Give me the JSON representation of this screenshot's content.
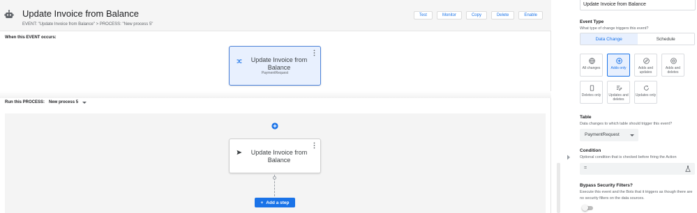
{
  "colors": {
    "accent": "#1a73e8",
    "selected_bg": "#e8f0fe",
    "header_bg": "#f5f5f5",
    "process_bg": "#f4f4f4"
  },
  "header": {
    "title": "Update Invoice from Balance",
    "breadcrumb": "EVENT: \"Update Invoice from Balance\" > PROCESS: \"New process 5\"",
    "icon": "robot-icon",
    "buttons": [
      "Test",
      "Monitor",
      "Copy",
      "Delete",
      "Enable"
    ]
  },
  "event_section": {
    "label": "When this EVENT occurs:",
    "card": {
      "title": "Update Invoice from Balance",
      "subtitle": "PaymentRequest",
      "icon": "shuffle-icon"
    }
  },
  "process_section": {
    "label": "Run this PROCESS:",
    "selected_process": "New process 5",
    "step_card": {
      "title": "Update Invoice from Balance",
      "icon": "send-icon"
    },
    "add_step_label": "Add a step"
  },
  "panel": {
    "name_value": "Update Invoice from Balance",
    "event_type": {
      "title": "Event Type",
      "hint": "What type of change triggers this event?",
      "tabs": [
        "Data Change",
        "Schedule"
      ],
      "active_tab": "Data Change"
    },
    "change_options": [
      {
        "label": "All changes",
        "icon": "globe-icon",
        "active": false
      },
      {
        "label": "Adds only",
        "icon": "add-circle-icon",
        "active": true
      },
      {
        "label": "Adds and updates",
        "icon": "add-update-icon",
        "active": false
      },
      {
        "label": "Adds and deletes",
        "icon": "add-delete-icon",
        "active": false
      },
      {
        "label": "Deletes only",
        "icon": "trash-icon",
        "active": false
      },
      {
        "label": "Updates and deletes",
        "icon": "edit-delete-icon",
        "active": false
      },
      {
        "label": "Updates only",
        "icon": "refresh-icon",
        "active": false
      }
    ],
    "table": {
      "title": "Table",
      "hint": "Data changes to which table should trigger this event?",
      "value": "PaymentRequest"
    },
    "condition": {
      "title": "Condition",
      "hint": "Optional condition that is checked before firing the Action",
      "value": "="
    },
    "bypass": {
      "title": "Bypass Security Filters?",
      "hint": "Execute this event and the Bots that it triggers as though there are no security filters on the data sources.",
      "enabled": false
    }
  }
}
